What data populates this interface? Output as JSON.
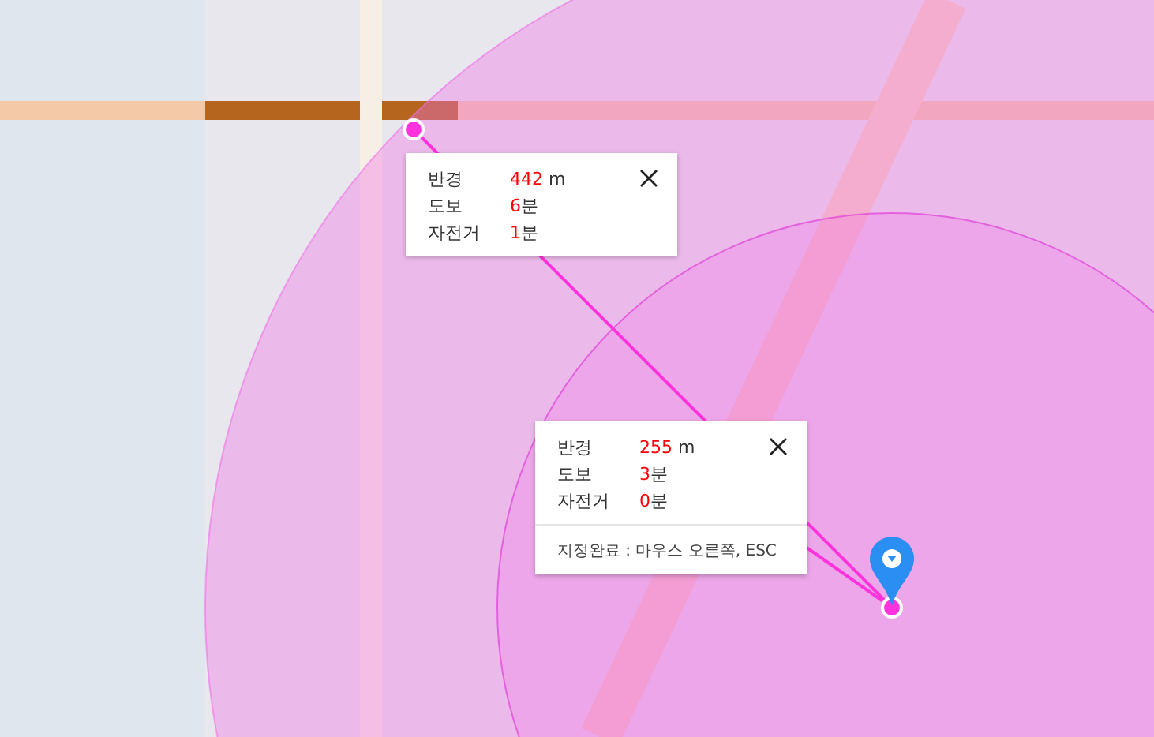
{
  "popups": [
    {
      "rows": [
        {
          "label": "반경",
          "value": "442",
          "unit": " m"
        },
        {
          "label": "도보",
          "value": "6",
          "unit": "분"
        },
        {
          "label": "자전거",
          "value": "1",
          "unit": "분"
        }
      ]
    },
    {
      "rows": [
        {
          "label": "반경",
          "value": "255",
          "unit": " m"
        },
        {
          "label": "도보",
          "value": "3",
          "unit": "분"
        },
        {
          "label": "자전거",
          "value": "0",
          "unit": "분"
        }
      ],
      "footer": "지정완료 : 마우스 오른쪽, ESC"
    }
  ]
}
